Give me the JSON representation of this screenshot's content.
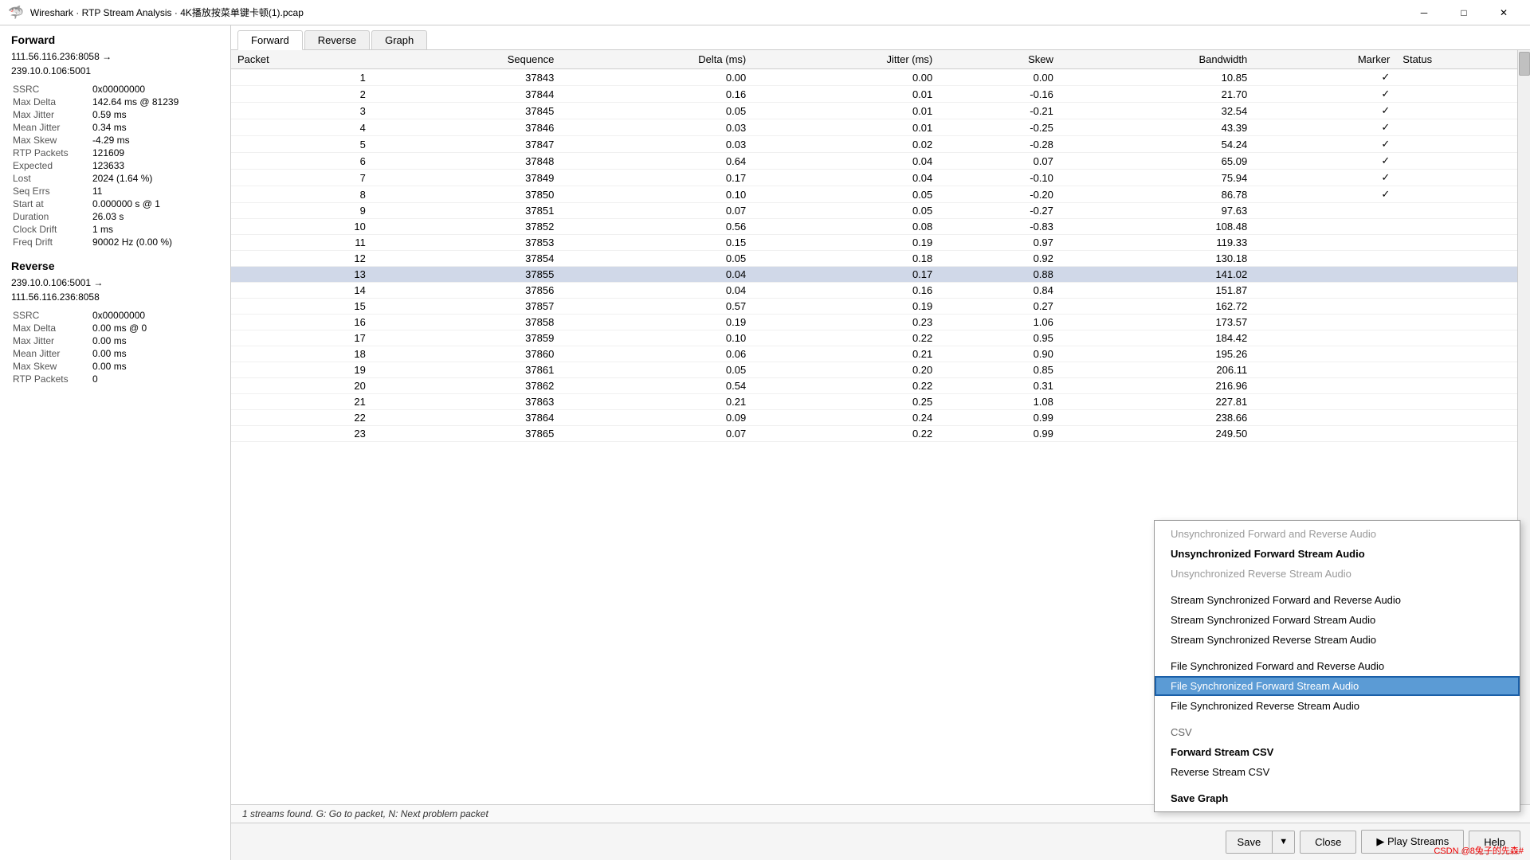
{
  "titlebar": {
    "title": "Wireshark · RTP Stream Analysis · 4K播放按菜单键卡顿(1).pcap",
    "min_label": "─",
    "max_label": "□",
    "close_label": "✕"
  },
  "left_panel": {
    "forward_title": "Forward",
    "forward_addr1": "111.56.116.236:8058 →",
    "forward_addr2": "239.10.0.106:5001",
    "forward_stats": [
      {
        "label": "SSRC",
        "value": "0x00000000"
      },
      {
        "label": "Max Delta",
        "value": "142.64 ms @ 81239"
      },
      {
        "label": "Max Jitter",
        "value": "0.59 ms"
      },
      {
        "label": "Mean Jitter",
        "value": "0.34 ms"
      },
      {
        "label": "Max Skew",
        "value": "-4.29 ms"
      },
      {
        "label": "RTP Packets",
        "value": "121609"
      },
      {
        "label": "Expected",
        "value": "123633"
      },
      {
        "label": "Lost",
        "value": "2024 (1.64 %)"
      },
      {
        "label": "Seq Errs",
        "value": "11"
      },
      {
        "label": "Start at",
        "value": "0.000000 s @ 1"
      },
      {
        "label": "Duration",
        "value": "26.03 s"
      },
      {
        "label": "Clock Drift",
        "value": "1 ms"
      },
      {
        "label": "Freq Drift",
        "value": "90002 Hz (0.00 %)"
      }
    ],
    "reverse_title": "Reverse",
    "reverse_addr1": "239.10.0.106:5001 →",
    "reverse_addr2": "111.56.116.236:8058",
    "reverse_stats": [
      {
        "label": "SSRC",
        "value": "0x00000000"
      },
      {
        "label": "Max Delta",
        "value": "0.00 ms @ 0"
      },
      {
        "label": "Max Jitter",
        "value": "0.00 ms"
      },
      {
        "label": "Mean Jitter",
        "value": "0.00 ms"
      },
      {
        "label": "Max Skew",
        "value": "0.00 ms"
      },
      {
        "label": "RTP Packets",
        "value": "0"
      }
    ]
  },
  "tabs": [
    "Forward",
    "Reverse",
    "Graph"
  ],
  "active_tab": 0,
  "table": {
    "columns": [
      "Packet",
      "Sequence",
      "Delta (ms)",
      "Jitter (ms)",
      "Skew",
      "Bandwidth",
      "Marker",
      "Status"
    ],
    "rows": [
      {
        "packet": "1",
        "sequence": "37843",
        "delta": "0.00",
        "jitter": "0.00",
        "skew": "0.00",
        "bandwidth": "10.85",
        "marker": "✓",
        "status": ""
      },
      {
        "packet": "2",
        "sequence": "37844",
        "delta": "0.16",
        "jitter": "0.01",
        "skew": "-0.16",
        "bandwidth": "21.70",
        "marker": "✓",
        "status": ""
      },
      {
        "packet": "3",
        "sequence": "37845",
        "delta": "0.05",
        "jitter": "0.01",
        "skew": "-0.21",
        "bandwidth": "32.54",
        "marker": "✓",
        "status": ""
      },
      {
        "packet": "4",
        "sequence": "37846",
        "delta": "0.03",
        "jitter": "0.01",
        "skew": "-0.25",
        "bandwidth": "43.39",
        "marker": "✓",
        "status": ""
      },
      {
        "packet": "5",
        "sequence": "37847",
        "delta": "0.03",
        "jitter": "0.02",
        "skew": "-0.28",
        "bandwidth": "54.24",
        "marker": "✓",
        "status": ""
      },
      {
        "packet": "6",
        "sequence": "37848",
        "delta": "0.64",
        "jitter": "0.04",
        "skew": "0.07",
        "bandwidth": "65.09",
        "marker": "✓",
        "status": ""
      },
      {
        "packet": "7",
        "sequence": "37849",
        "delta": "0.17",
        "jitter": "0.04",
        "skew": "-0.10",
        "bandwidth": "75.94",
        "marker": "✓",
        "status": ""
      },
      {
        "packet": "8",
        "sequence": "37850",
        "delta": "0.10",
        "jitter": "0.05",
        "skew": "-0.20",
        "bandwidth": "86.78",
        "marker": "✓",
        "status": ""
      },
      {
        "packet": "9",
        "sequence": "37851",
        "delta": "0.07",
        "jitter": "0.05",
        "skew": "-0.27",
        "bandwidth": "97.63",
        "marker": "",
        "status": ""
      },
      {
        "packet": "10",
        "sequence": "37852",
        "delta": "0.56",
        "jitter": "0.08",
        "skew": "-0.83",
        "bandwidth": "108.48",
        "marker": "",
        "status": ""
      },
      {
        "packet": "11",
        "sequence": "37853",
        "delta": "0.15",
        "jitter": "0.19",
        "skew": "0.97",
        "bandwidth": "119.33",
        "marker": "",
        "status": ""
      },
      {
        "packet": "12",
        "sequence": "37854",
        "delta": "0.05",
        "jitter": "0.18",
        "skew": "0.92",
        "bandwidth": "130.18",
        "marker": "",
        "status": ""
      },
      {
        "packet": "13",
        "sequence": "37855",
        "delta": "0.04",
        "jitter": "0.17",
        "skew": "0.88",
        "bandwidth": "141.02",
        "marker": "",
        "status": "",
        "highlighted": true
      },
      {
        "packet": "14",
        "sequence": "37856",
        "delta": "0.04",
        "jitter": "0.16",
        "skew": "0.84",
        "bandwidth": "151.87",
        "marker": "",
        "status": ""
      },
      {
        "packet": "15",
        "sequence": "37857",
        "delta": "0.57",
        "jitter": "0.19",
        "skew": "0.27",
        "bandwidth": "162.72",
        "marker": "",
        "status": ""
      },
      {
        "packet": "16",
        "sequence": "37858",
        "delta": "0.19",
        "jitter": "0.23",
        "skew": "1.06",
        "bandwidth": "173.57",
        "marker": "",
        "status": ""
      },
      {
        "packet": "17",
        "sequence": "37859",
        "delta": "0.10",
        "jitter": "0.22",
        "skew": "0.95",
        "bandwidth": "184.42",
        "marker": "",
        "status": ""
      },
      {
        "packet": "18",
        "sequence": "37860",
        "delta": "0.06",
        "jitter": "0.21",
        "skew": "0.90",
        "bandwidth": "195.26",
        "marker": "",
        "status": ""
      },
      {
        "packet": "19",
        "sequence": "37861",
        "delta": "0.05",
        "jitter": "0.20",
        "skew": "0.85",
        "bandwidth": "206.11",
        "marker": "",
        "status": ""
      },
      {
        "packet": "20",
        "sequence": "37862",
        "delta": "0.54",
        "jitter": "0.22",
        "skew": "0.31",
        "bandwidth": "216.96",
        "marker": "",
        "status": ""
      },
      {
        "packet": "21",
        "sequence": "37863",
        "delta": "0.21",
        "jitter": "0.25",
        "skew": "1.08",
        "bandwidth": "227.81",
        "marker": "",
        "status": ""
      },
      {
        "packet": "22",
        "sequence": "37864",
        "delta": "0.09",
        "jitter": "0.24",
        "skew": "0.99",
        "bandwidth": "238.66",
        "marker": "",
        "status": ""
      },
      {
        "packet": "23",
        "sequence": "37865",
        "delta": "0.07",
        "jitter": "0.22",
        "skew": "0.99",
        "bandwidth": "249.50",
        "marker": "",
        "status": ""
      }
    ]
  },
  "status_bar": {
    "text": "1 streams found. G: Go to packet, N: Next problem packet"
  },
  "bottom_buttons": {
    "save_label": "Save",
    "close_label": "Close",
    "play_streams_label": "▶ Play Streams",
    "help_label": "Help"
  },
  "dropdown_menu": {
    "items": [
      {
        "id": "unsync-fwd-rev",
        "label": "Unsynchronized Forward and Reverse Audio",
        "type": "disabled"
      },
      {
        "id": "unsync-fwd",
        "label": "Unsynchronized Forward Stream Audio",
        "type": "bold"
      },
      {
        "id": "unsync-rev",
        "label": "Unsynchronized Reverse Stream Audio",
        "type": "disabled"
      },
      {
        "id": "sep1",
        "type": "separator"
      },
      {
        "id": "sync-fwd-rev",
        "label": "Stream Synchronized Forward and Reverse Audio",
        "type": "normal"
      },
      {
        "id": "sync-fwd",
        "label": "Stream Synchronized Forward Stream Audio",
        "type": "normal"
      },
      {
        "id": "sync-rev",
        "label": "Stream Synchronized Reverse Stream Audio",
        "type": "normal"
      },
      {
        "id": "sep2",
        "type": "separator"
      },
      {
        "id": "file-fwd-rev",
        "label": "File Synchronized Forward and Reverse Audio",
        "type": "normal"
      },
      {
        "id": "file-fwd",
        "label": "File Synchronized Forward Stream Audio",
        "type": "selected"
      },
      {
        "id": "file-rev",
        "label": "File Synchronized Reverse Stream Audio",
        "type": "normal"
      },
      {
        "id": "sep3",
        "type": "separator"
      },
      {
        "id": "csv-label",
        "label": "CSV",
        "type": "section"
      },
      {
        "id": "fwd-csv",
        "label": "Forward Stream CSV",
        "type": "bold"
      },
      {
        "id": "rev-csv",
        "label": "Reverse Stream CSV",
        "type": "normal"
      },
      {
        "id": "sep4",
        "type": "separator"
      },
      {
        "id": "save-graph",
        "label": "Save Graph",
        "type": "bold"
      }
    ]
  },
  "watermark": "CSDN @8兔子的先森#"
}
